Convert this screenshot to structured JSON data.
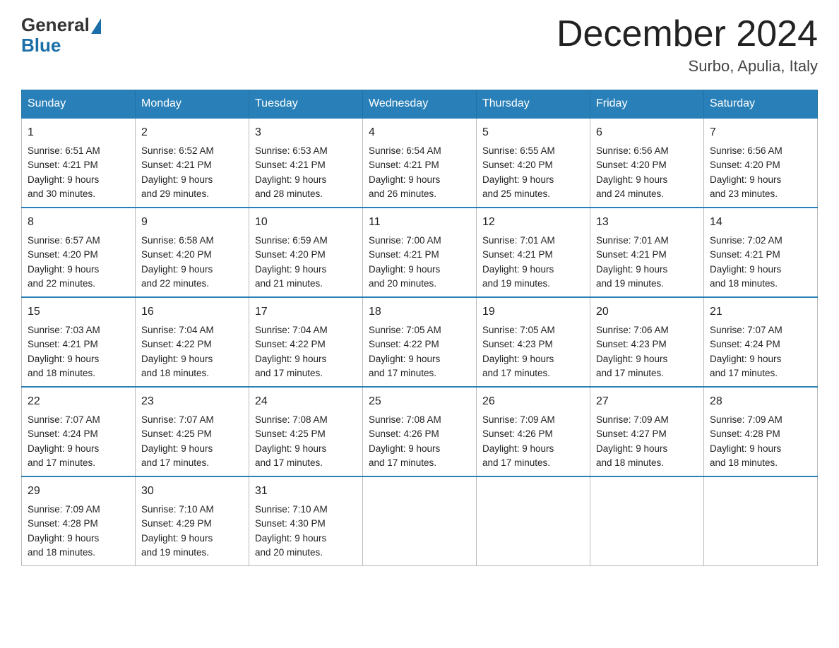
{
  "header": {
    "logo_general": "General",
    "logo_blue": "Blue",
    "month_title": "December 2024",
    "location": "Surbo, Apulia, Italy"
  },
  "days_of_week": [
    "Sunday",
    "Monday",
    "Tuesday",
    "Wednesday",
    "Thursday",
    "Friday",
    "Saturday"
  ],
  "weeks": [
    [
      {
        "day": "1",
        "sunrise": "6:51 AM",
        "sunset": "4:21 PM",
        "daylight": "9 hours and 30 minutes."
      },
      {
        "day": "2",
        "sunrise": "6:52 AM",
        "sunset": "4:21 PM",
        "daylight": "9 hours and 29 minutes."
      },
      {
        "day": "3",
        "sunrise": "6:53 AM",
        "sunset": "4:21 PM",
        "daylight": "9 hours and 28 minutes."
      },
      {
        "day": "4",
        "sunrise": "6:54 AM",
        "sunset": "4:21 PM",
        "daylight": "9 hours and 26 minutes."
      },
      {
        "day": "5",
        "sunrise": "6:55 AM",
        "sunset": "4:20 PM",
        "daylight": "9 hours and 25 minutes."
      },
      {
        "day": "6",
        "sunrise": "6:56 AM",
        "sunset": "4:20 PM",
        "daylight": "9 hours and 24 minutes."
      },
      {
        "day": "7",
        "sunrise": "6:56 AM",
        "sunset": "4:20 PM",
        "daylight": "9 hours and 23 minutes."
      }
    ],
    [
      {
        "day": "8",
        "sunrise": "6:57 AM",
        "sunset": "4:20 PM",
        "daylight": "9 hours and 22 minutes."
      },
      {
        "day": "9",
        "sunrise": "6:58 AM",
        "sunset": "4:20 PM",
        "daylight": "9 hours and 22 minutes."
      },
      {
        "day": "10",
        "sunrise": "6:59 AM",
        "sunset": "4:20 PM",
        "daylight": "9 hours and 21 minutes."
      },
      {
        "day": "11",
        "sunrise": "7:00 AM",
        "sunset": "4:21 PM",
        "daylight": "9 hours and 20 minutes."
      },
      {
        "day": "12",
        "sunrise": "7:01 AM",
        "sunset": "4:21 PM",
        "daylight": "9 hours and 19 minutes."
      },
      {
        "day": "13",
        "sunrise": "7:01 AM",
        "sunset": "4:21 PM",
        "daylight": "9 hours and 19 minutes."
      },
      {
        "day": "14",
        "sunrise": "7:02 AM",
        "sunset": "4:21 PM",
        "daylight": "9 hours and 18 minutes."
      }
    ],
    [
      {
        "day": "15",
        "sunrise": "7:03 AM",
        "sunset": "4:21 PM",
        "daylight": "9 hours and 18 minutes."
      },
      {
        "day": "16",
        "sunrise": "7:04 AM",
        "sunset": "4:22 PM",
        "daylight": "9 hours and 18 minutes."
      },
      {
        "day": "17",
        "sunrise": "7:04 AM",
        "sunset": "4:22 PM",
        "daylight": "9 hours and 17 minutes."
      },
      {
        "day": "18",
        "sunrise": "7:05 AM",
        "sunset": "4:22 PM",
        "daylight": "9 hours and 17 minutes."
      },
      {
        "day": "19",
        "sunrise": "7:05 AM",
        "sunset": "4:23 PM",
        "daylight": "9 hours and 17 minutes."
      },
      {
        "day": "20",
        "sunrise": "7:06 AM",
        "sunset": "4:23 PM",
        "daylight": "9 hours and 17 minutes."
      },
      {
        "day": "21",
        "sunrise": "7:07 AM",
        "sunset": "4:24 PM",
        "daylight": "9 hours and 17 minutes."
      }
    ],
    [
      {
        "day": "22",
        "sunrise": "7:07 AM",
        "sunset": "4:24 PM",
        "daylight": "9 hours and 17 minutes."
      },
      {
        "day": "23",
        "sunrise": "7:07 AM",
        "sunset": "4:25 PM",
        "daylight": "9 hours and 17 minutes."
      },
      {
        "day": "24",
        "sunrise": "7:08 AM",
        "sunset": "4:25 PM",
        "daylight": "9 hours and 17 minutes."
      },
      {
        "day": "25",
        "sunrise": "7:08 AM",
        "sunset": "4:26 PM",
        "daylight": "9 hours and 17 minutes."
      },
      {
        "day": "26",
        "sunrise": "7:09 AM",
        "sunset": "4:26 PM",
        "daylight": "9 hours and 17 minutes."
      },
      {
        "day": "27",
        "sunrise": "7:09 AM",
        "sunset": "4:27 PM",
        "daylight": "9 hours and 18 minutes."
      },
      {
        "day": "28",
        "sunrise": "7:09 AM",
        "sunset": "4:28 PM",
        "daylight": "9 hours and 18 minutes."
      }
    ],
    [
      {
        "day": "29",
        "sunrise": "7:09 AM",
        "sunset": "4:28 PM",
        "daylight": "9 hours and 18 minutes."
      },
      {
        "day": "30",
        "sunrise": "7:10 AM",
        "sunset": "4:29 PM",
        "daylight": "9 hours and 19 minutes."
      },
      {
        "day": "31",
        "sunrise": "7:10 AM",
        "sunset": "4:30 PM",
        "daylight": "9 hours and 20 minutes."
      },
      null,
      null,
      null,
      null
    ]
  ],
  "labels": {
    "sunrise": "Sunrise:",
    "sunset": "Sunset:",
    "daylight": "Daylight:"
  }
}
